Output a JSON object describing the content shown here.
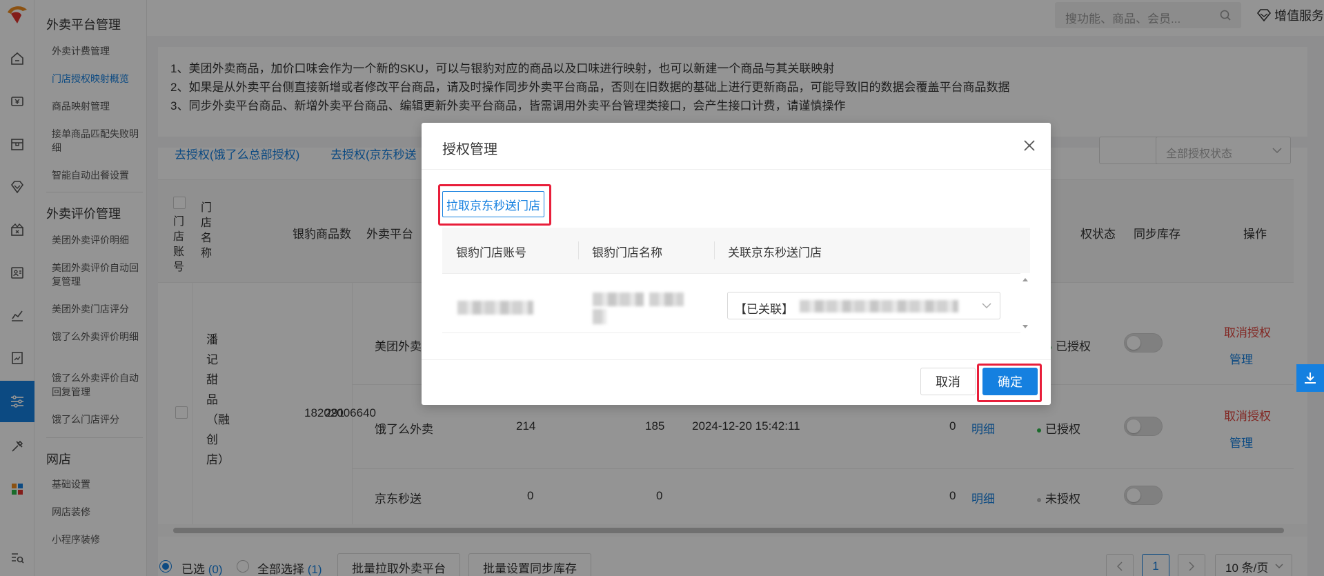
{
  "brand": {
    "accent": "#1580e0",
    "danger": "#e0463f",
    "highlight": "#e81e3a"
  },
  "rail": {
    "icons": [
      "logo-icon",
      "home-icon",
      "money-icon",
      "store-icon",
      "diamond-icon",
      "gift-icon",
      "id-card-icon",
      "chart-icon",
      "report-icon",
      "settings-sliders-icon",
      "tools-icon",
      "apps-icon",
      "menu-search-icon"
    ],
    "active": "settings-sliders-icon"
  },
  "submenu": {
    "group1": {
      "title": "外卖平台管理",
      "items": [
        "外卖计费管理",
        "门店授权映射概览",
        "商品映射管理",
        "接单商品匹配失败明细",
        "智能自动出餐设置"
      ],
      "active_index": 1
    },
    "group2": {
      "title": "外卖评价管理",
      "items": [
        "美团外卖评价明细",
        "美团外卖评价自动回复管理",
        "美团外卖门店评分",
        "饿了么外卖评价明细",
        "饿了么外卖评价自动回复管理",
        "饿了么门店评分"
      ]
    },
    "group3": {
      "title": "网店",
      "items": [
        "基础设置",
        "网店装修",
        "小程序装修"
      ]
    }
  },
  "header": {
    "search_placeholder": "搜功能、商品、会员...",
    "value_added": "增值服务"
  },
  "notice": {
    "lines": [
      "1、美团外卖商品，加价口味会作为一个新的SKU，可以与银豹对应的商品以及口味进行映射，也可以新建一个商品与其关联映射",
      "2、如果是从外卖平台侧直接新增或者修改平台商品，请及时操作同步外卖平台商品，否则在旧数据的基础上进行更新商品，可能导致旧的数据会覆盖平台商品数据",
      "3、同步外卖平台商品、新增外卖平台商品、编辑更新外卖平台商品，皆需调用外卖平台管理类接口，会产生接口计费，请谨慎操作"
    ]
  },
  "toolbar": {
    "link1": "去授权(饿了么总部授权)",
    "link2": "去授权(京东秒送",
    "filter_status": "全部授权状态"
  },
  "table": {
    "headers": {
      "account": "门店账号",
      "name": "门店名称",
      "product_count": "银豹商品数",
      "platform": "外卖平台",
      "auth_status": "权状态",
      "sync_stock": "同步库存",
      "actions": "操作"
    },
    "store": {
      "account": "18202006640",
      "name": "潘记甜品（融创店）",
      "product_count": "291"
    },
    "rows": [
      {
        "platform": "美团外卖",
        "col_a": "",
        "col_b": "",
        "time": "",
        "col_c": "",
        "detail": "",
        "status": "已授权",
        "status_color": "#2eb84b",
        "cancel": "取消授权",
        "manage": "管理"
      },
      {
        "platform": "饿了么外卖",
        "col_a": "214",
        "col_b": "185",
        "time": "2024-12-20 15:42:11",
        "col_c": "0",
        "detail": "明细",
        "status": "已授权",
        "status_color": "#2eb84b",
        "cancel": "取消授权",
        "manage": "管理"
      },
      {
        "platform": "京东秒送",
        "col_a": "0",
        "col_b": "0",
        "time": "",
        "col_c": "0",
        "detail": "明细",
        "status": "未授权",
        "status_color": "#bbbbbb",
        "cancel": "",
        "manage": ""
      }
    ]
  },
  "footer": {
    "selected_label": "已选",
    "selected_count": "(0)",
    "select_all_label": "全部选择",
    "select_all_count": "(1)",
    "batch_pull": "批量拉取外卖平台",
    "batch_sync": "批量设置同步库存",
    "page": "1",
    "page_size": "10 条/页"
  },
  "dialog": {
    "title": "授权管理",
    "pull_button": "拉取京东秒送门店",
    "columns": [
      "银豹门店账号",
      "银豹门店名称",
      "关联京东秒送门店"
    ],
    "linked_prefix": "【已关联】",
    "cancel": "取消",
    "ok": "确定"
  }
}
